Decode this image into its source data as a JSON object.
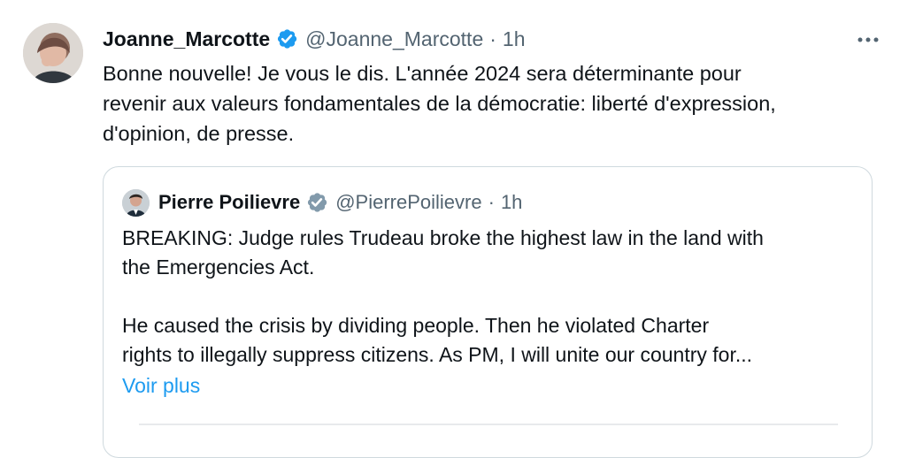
{
  "tweet": {
    "author_name": "Joanne_Marcotte",
    "author_handle": "@Joanne_Marcotte",
    "separator": "·",
    "time": "1h",
    "text": "Bonne nouvelle! Je vous le dis. L'année 2024 sera déterminante pour\nrevenir aux valeurs fondamentales de la démocratie: liberté d'expression,\nd'opinion, de presse.",
    "more_icon": "more-horizontal-icon",
    "verified_icon": "verified-badge-icon",
    "verified_color": "#1d9bf0"
  },
  "quote": {
    "author_name": "Pierre Poilievre",
    "author_handle": "@PierrePoilievre",
    "separator": "·",
    "time": "1h",
    "text": "BREAKING: Judge rules Trudeau broke the highest law in the land with\nthe Emergencies Act.\n\nHe caused the crisis by dividing people. Then he violated Charter\nrights to illegally suppress citizens. As PM, I will unite our country for...",
    "see_more": "Voir plus",
    "verified_icon": "gray-verified-badge-icon",
    "verified_color": "#829aab"
  }
}
